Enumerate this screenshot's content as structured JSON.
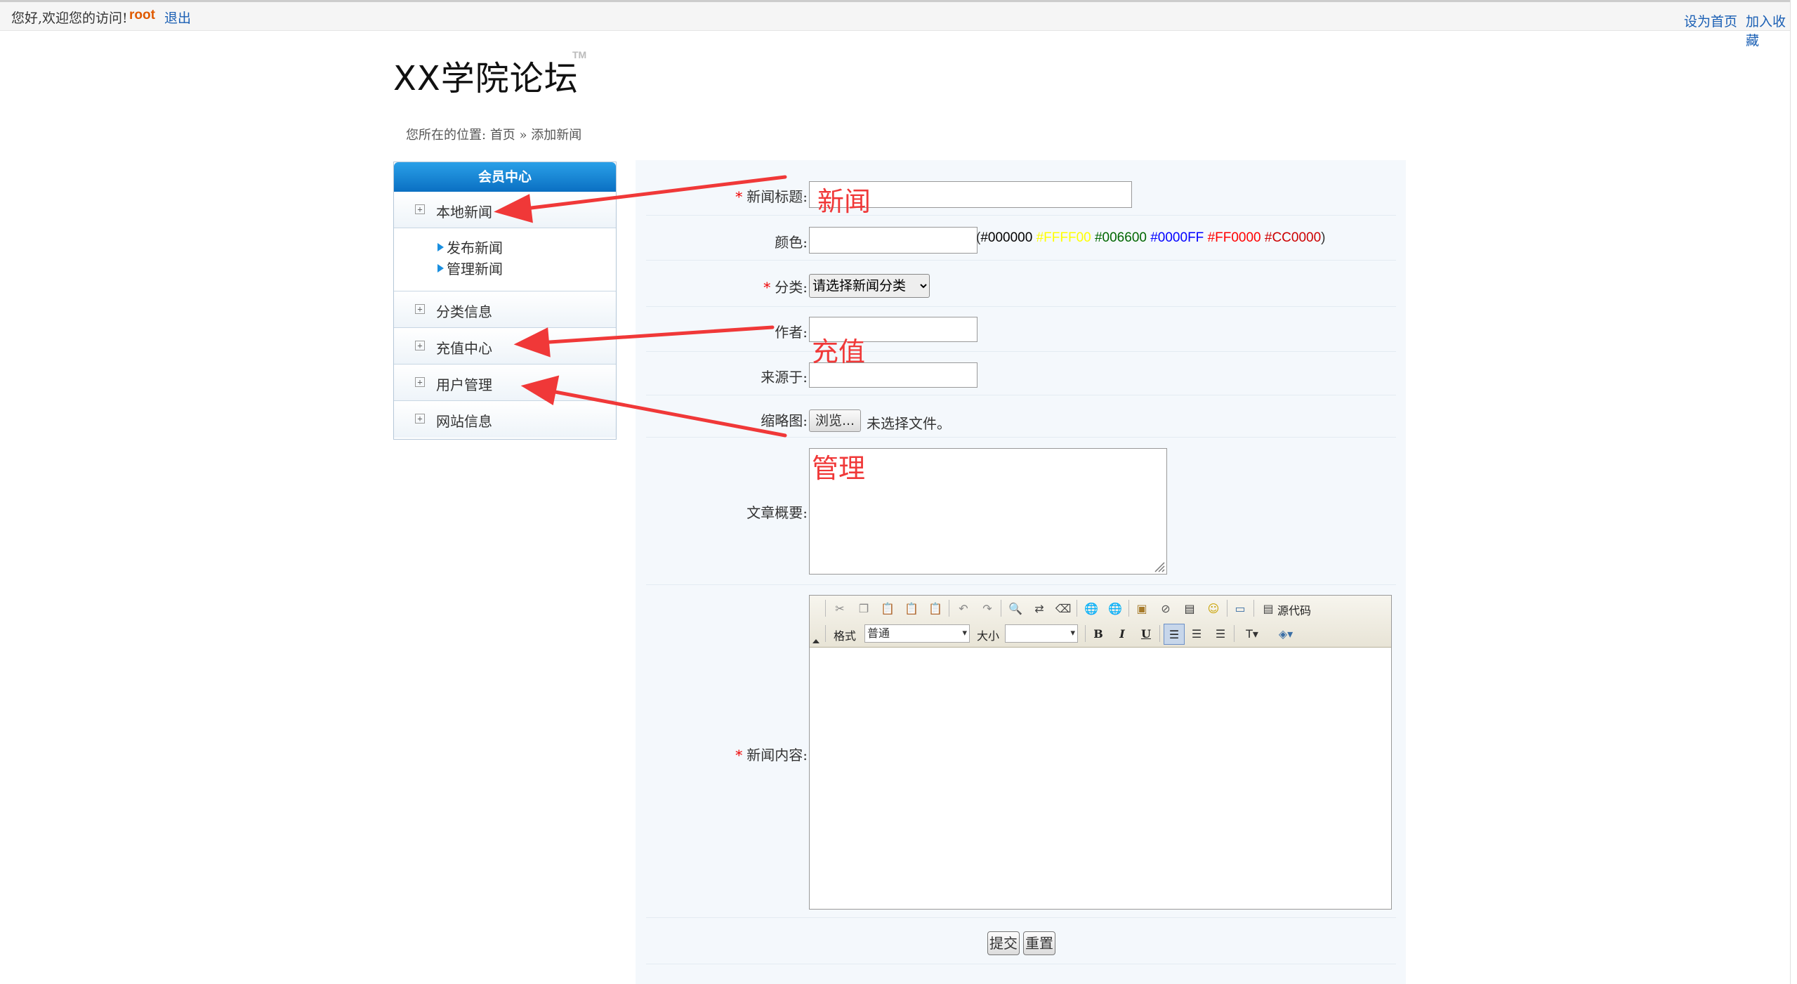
{
  "topbar": {
    "welcome": "您好,欢迎您的访问!",
    "user": "root",
    "logout": "退出",
    "set_home": "设为首页",
    "add_favorite": "加入收藏"
  },
  "header": {
    "logo": "XX学院论坛",
    "tm": "TM"
  },
  "breadcrumb": {
    "prefix": "您所在的位置:",
    "home": "首页",
    "sep": "»",
    "current": "添加新闻"
  },
  "sidebar": {
    "title": "会员中心",
    "items": [
      {
        "label": "本地新闻",
        "expanded": true,
        "children": [
          "发布新闻",
          "管理新闻"
        ]
      },
      {
        "label": "分类信息"
      },
      {
        "label": "充值中心"
      },
      {
        "label": "用户管理"
      },
      {
        "label": "网站信息"
      }
    ]
  },
  "form": {
    "title_label": "新闻标题:",
    "color_label": "颜色:",
    "colors": [
      {
        "text": "#000000",
        "color": "#000000"
      },
      {
        "text": "#FFFF00",
        "color": "#FFFF00"
      },
      {
        "text": "#006600",
        "color": "#006600"
      },
      {
        "text": "#0000FF",
        "color": "#0000FF"
      },
      {
        "text": "#FF0000",
        "color": "#FF0000"
      },
      {
        "text": "#CC0000",
        "color": "#CC0000"
      }
    ],
    "category_label": "分类:",
    "category_selected": "请选择新闻分类",
    "author_label": "作者:",
    "source_label": "来源于:",
    "thumb_label": "缩略图:",
    "browse": "浏览...",
    "no_file": "未选择文件。",
    "summary_label": "文章概要:",
    "content_label": "新闻内容:",
    "submit": "提交",
    "reset": "重置"
  },
  "editor": {
    "source_code": "源代码",
    "format_label": "格式",
    "format_value": "普通",
    "size_label": "大小",
    "size_value": "",
    "bold": "B",
    "italic": "I",
    "underline": "U"
  },
  "annotations": {
    "news": "新闻",
    "recharge": "充值",
    "manage": "管理",
    "color": "#f03838"
  }
}
